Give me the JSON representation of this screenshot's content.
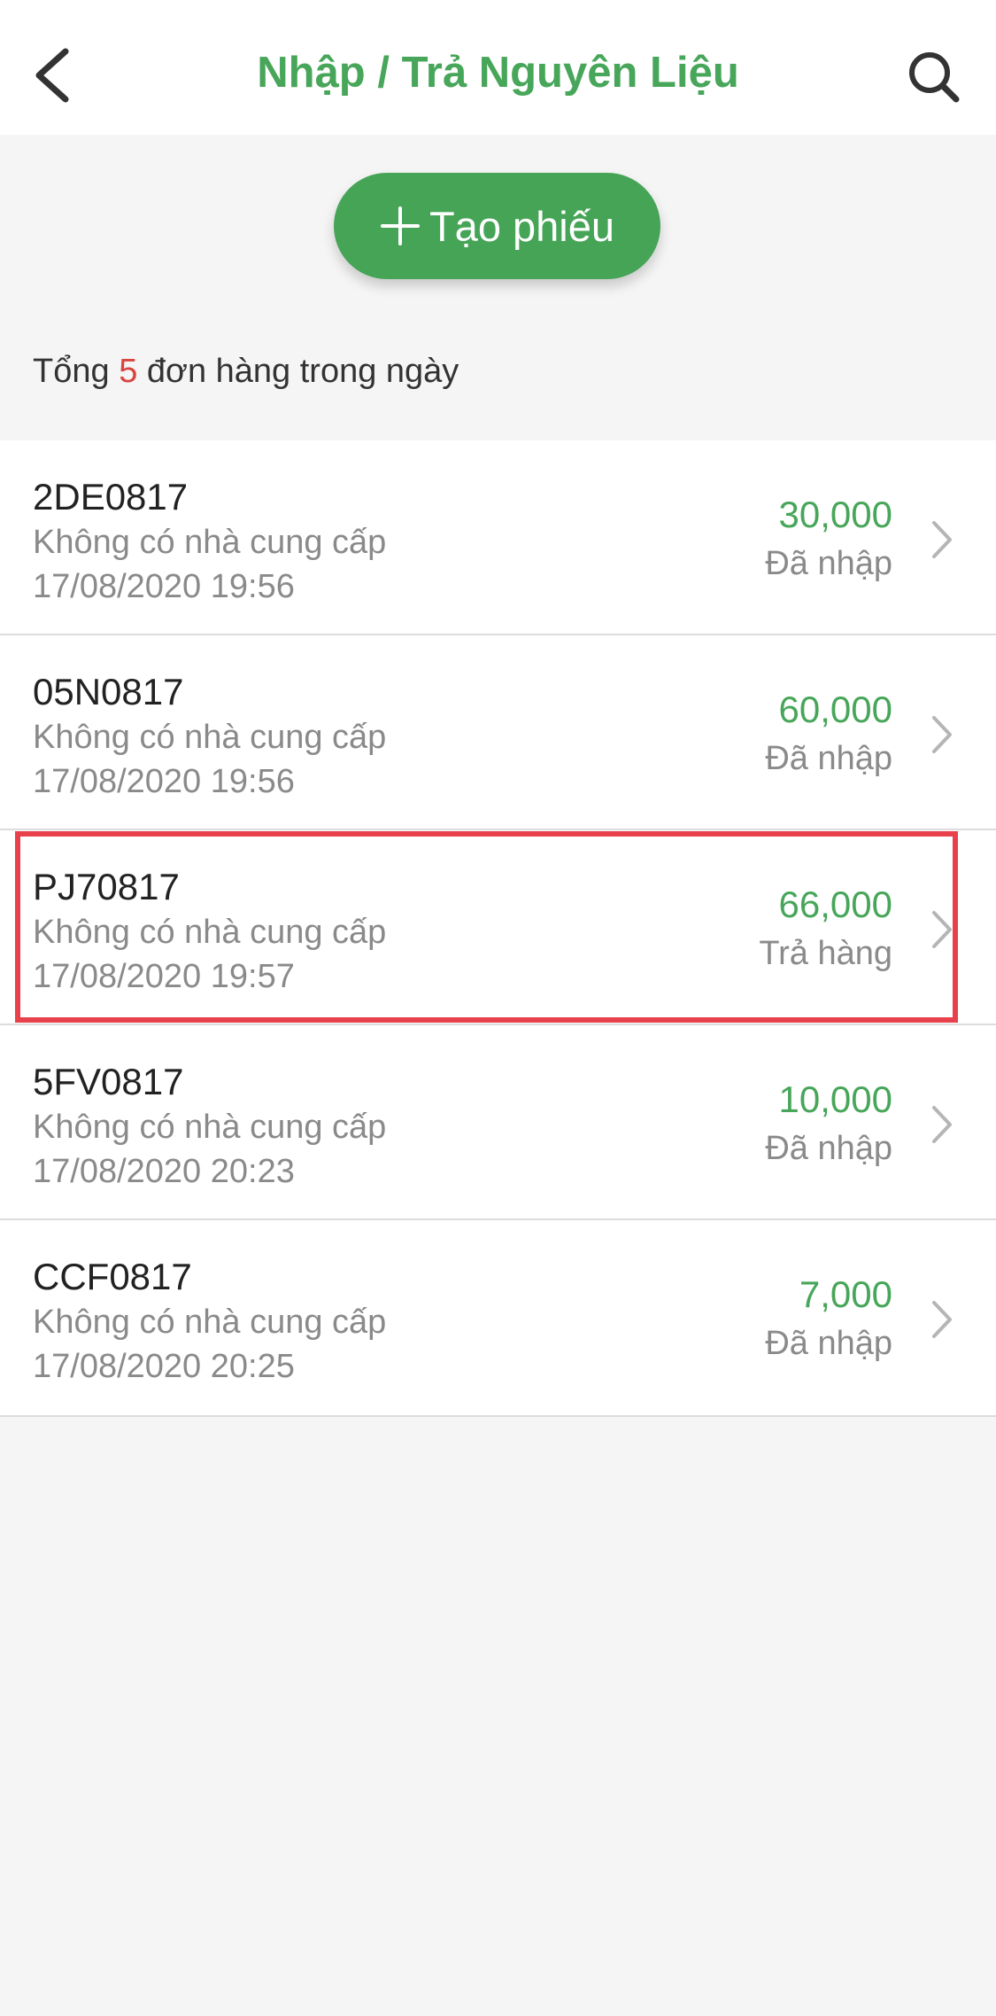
{
  "header": {
    "title": "Nhập / Trả Nguyên Liệu",
    "back_icon": "chevron-left-icon",
    "search_icon": "search-icon"
  },
  "create_button": {
    "label": "Tạo phiếu",
    "icon": "plus-icon",
    "color": "#46a457"
  },
  "summary": {
    "prefix": "Tổng",
    "count": "5",
    "suffix": "đơn hàng trong ngày"
  },
  "orders": [
    {
      "code": "2DE0817",
      "supplier": "Không có nhà cung cấp",
      "time": "17/08/2020 19:56",
      "amount": "30,000",
      "status": "Đã nhập"
    },
    {
      "code": "05N0817",
      "supplier": "Không có nhà cung cấp",
      "time": "17/08/2020 19:56",
      "amount": "60,000",
      "status": "Đã nhập"
    },
    {
      "code": "PJ70817",
      "supplier": "Không có nhà cung cấp",
      "time": "17/08/2020 19:57",
      "amount": "66,000",
      "status": "Trả hàng"
    },
    {
      "code": "5FV0817",
      "supplier": "Không có nhà cung cấp",
      "time": "17/08/2020 20:23",
      "amount": "10,000",
      "status": "Đã nhập"
    },
    {
      "code": "CCF0817",
      "supplier": "Không có nhà cung cấp",
      "time": "17/08/2020 20:25",
      "amount": "7,000",
      "status": "Đã nhập"
    }
  ],
  "colors": {
    "accent": "#47a659",
    "highlight": "#e8414c",
    "count": "#d9443f"
  }
}
